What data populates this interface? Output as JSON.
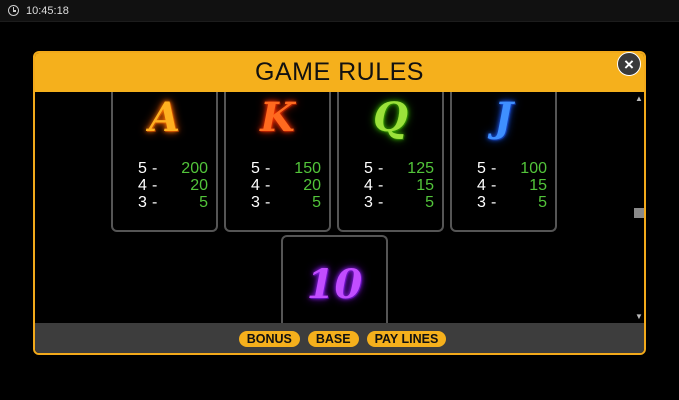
{
  "status_bar": {
    "time": "10:45:18"
  },
  "dialog": {
    "title": "GAME RULES",
    "close_label": "×"
  },
  "symbols": [
    {
      "symbol": "A",
      "pays": [
        {
          "count": "5",
          "value": "200"
        },
        {
          "count": "4",
          "value": "20"
        },
        {
          "count": "3",
          "value": "5"
        }
      ]
    },
    {
      "symbol": "K",
      "pays": [
        {
          "count": "5",
          "value": "150"
        },
        {
          "count": "4",
          "value": "20"
        },
        {
          "count": "3",
          "value": "5"
        }
      ]
    },
    {
      "symbol": "Q",
      "pays": [
        {
          "count": "5",
          "value": "125"
        },
        {
          "count": "4",
          "value": "15"
        },
        {
          "count": "3",
          "value": "5"
        }
      ]
    },
    {
      "symbol": "J",
      "pays": [
        {
          "count": "5",
          "value": "100"
        },
        {
          "count": "4",
          "value": "15"
        },
        {
          "count": "3",
          "value": "5"
        }
      ]
    },
    {
      "symbol": "10"
    }
  ],
  "dash": "-",
  "tabs": [
    {
      "label": "BONUS"
    },
    {
      "label": "BASE"
    },
    {
      "label": "PAY LINES"
    }
  ],
  "scroll": {
    "up": "▲",
    "down": "▼"
  },
  "colors": {
    "accent": "#f5b01c",
    "pay_value": "#52c43a",
    "footer": "#3d3d3d"
  }
}
